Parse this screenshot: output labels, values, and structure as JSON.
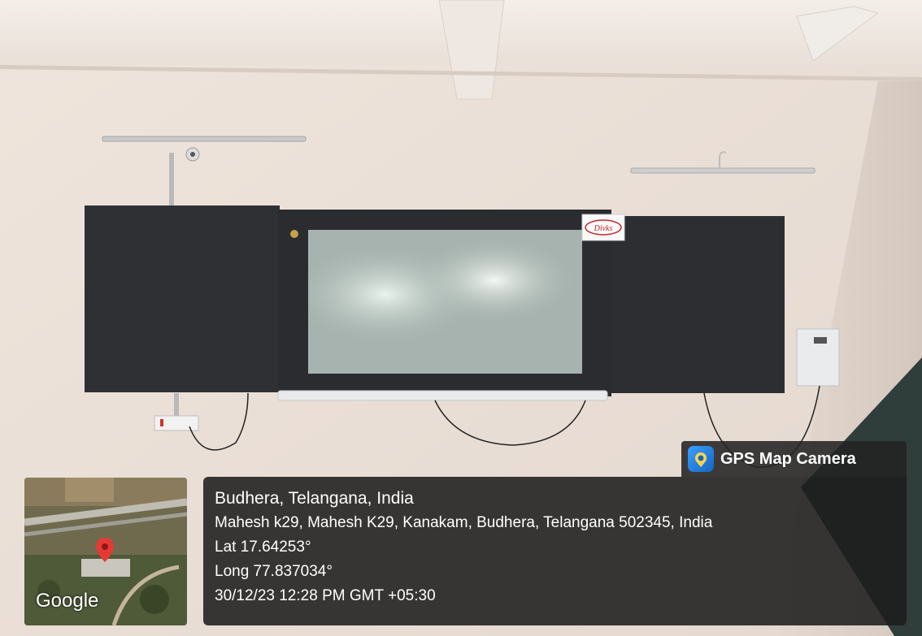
{
  "badge": {
    "app_name": "GPS Map Camera",
    "icon": "camera-pin-icon"
  },
  "location": {
    "title": "Budhera, Telangana, India",
    "address": "Mahesh k29, Mahesh K29, Kanakam, Budhera, Telangana 502345, India",
    "latitude": "Lat 17.64253°",
    "longitude": "Long 77.837034°",
    "datetime": "30/12/23 12:28 PM GMT +05:30"
  },
  "map": {
    "attribution": "Google",
    "pin_icon": "map-pin-icon"
  },
  "board": {
    "brand_label": "Divks"
  },
  "colors": {
    "wall": "#ece2da",
    "panel_dark": "#2b2d31",
    "pin_red": "#e53935",
    "badge_blue": "#1e88e5"
  }
}
